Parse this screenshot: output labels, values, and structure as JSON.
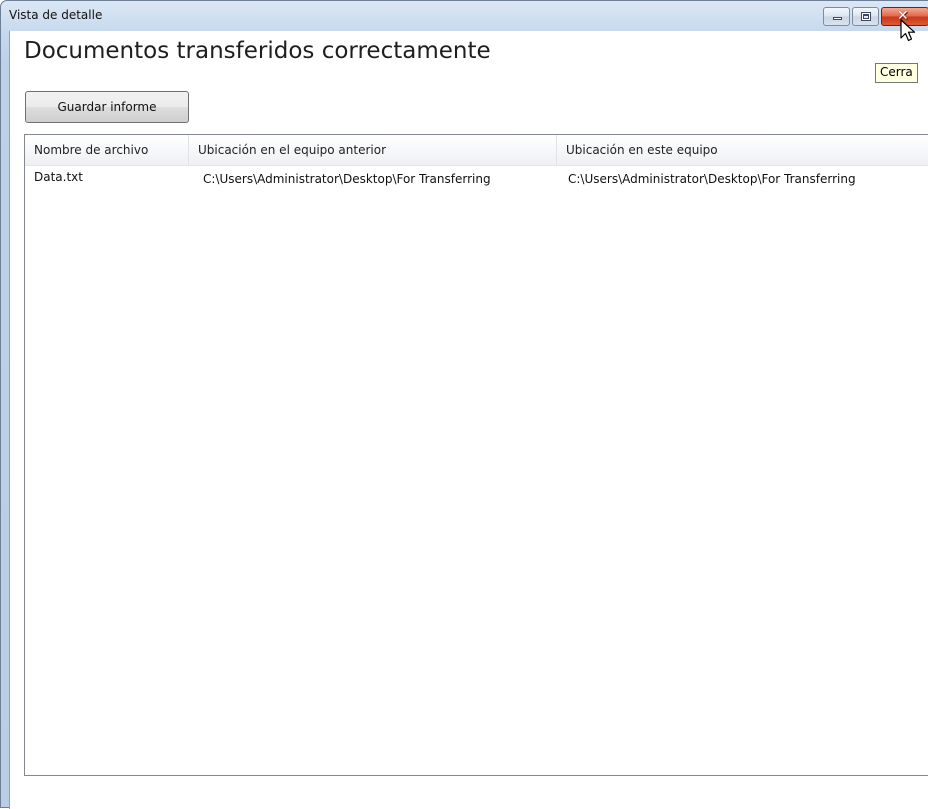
{
  "window": {
    "title": "Vista de detalle",
    "close_tooltip": "Cerra"
  },
  "main": {
    "heading": "Documentos transferidos correctamente",
    "save_button_label": "Guardar informe"
  },
  "table": {
    "columns": [
      "Nombre de archivo",
      "Ubicación en el equipo anterior",
      "Ubicación en este equipo"
    ],
    "rows": [
      {
        "file_name": "Data.txt",
        "previous_location": "C:\\Users\\Administrator\\Desktop\\For Transferring",
        "current_location": "C:\\Users\\Administrator\\Desktop\\For Transferring"
      }
    ]
  },
  "icons": {
    "minimize": "minimize-icon",
    "maximize": "maximize-icon",
    "close": "close-icon",
    "cursor": "mouse-pointer-icon"
  }
}
